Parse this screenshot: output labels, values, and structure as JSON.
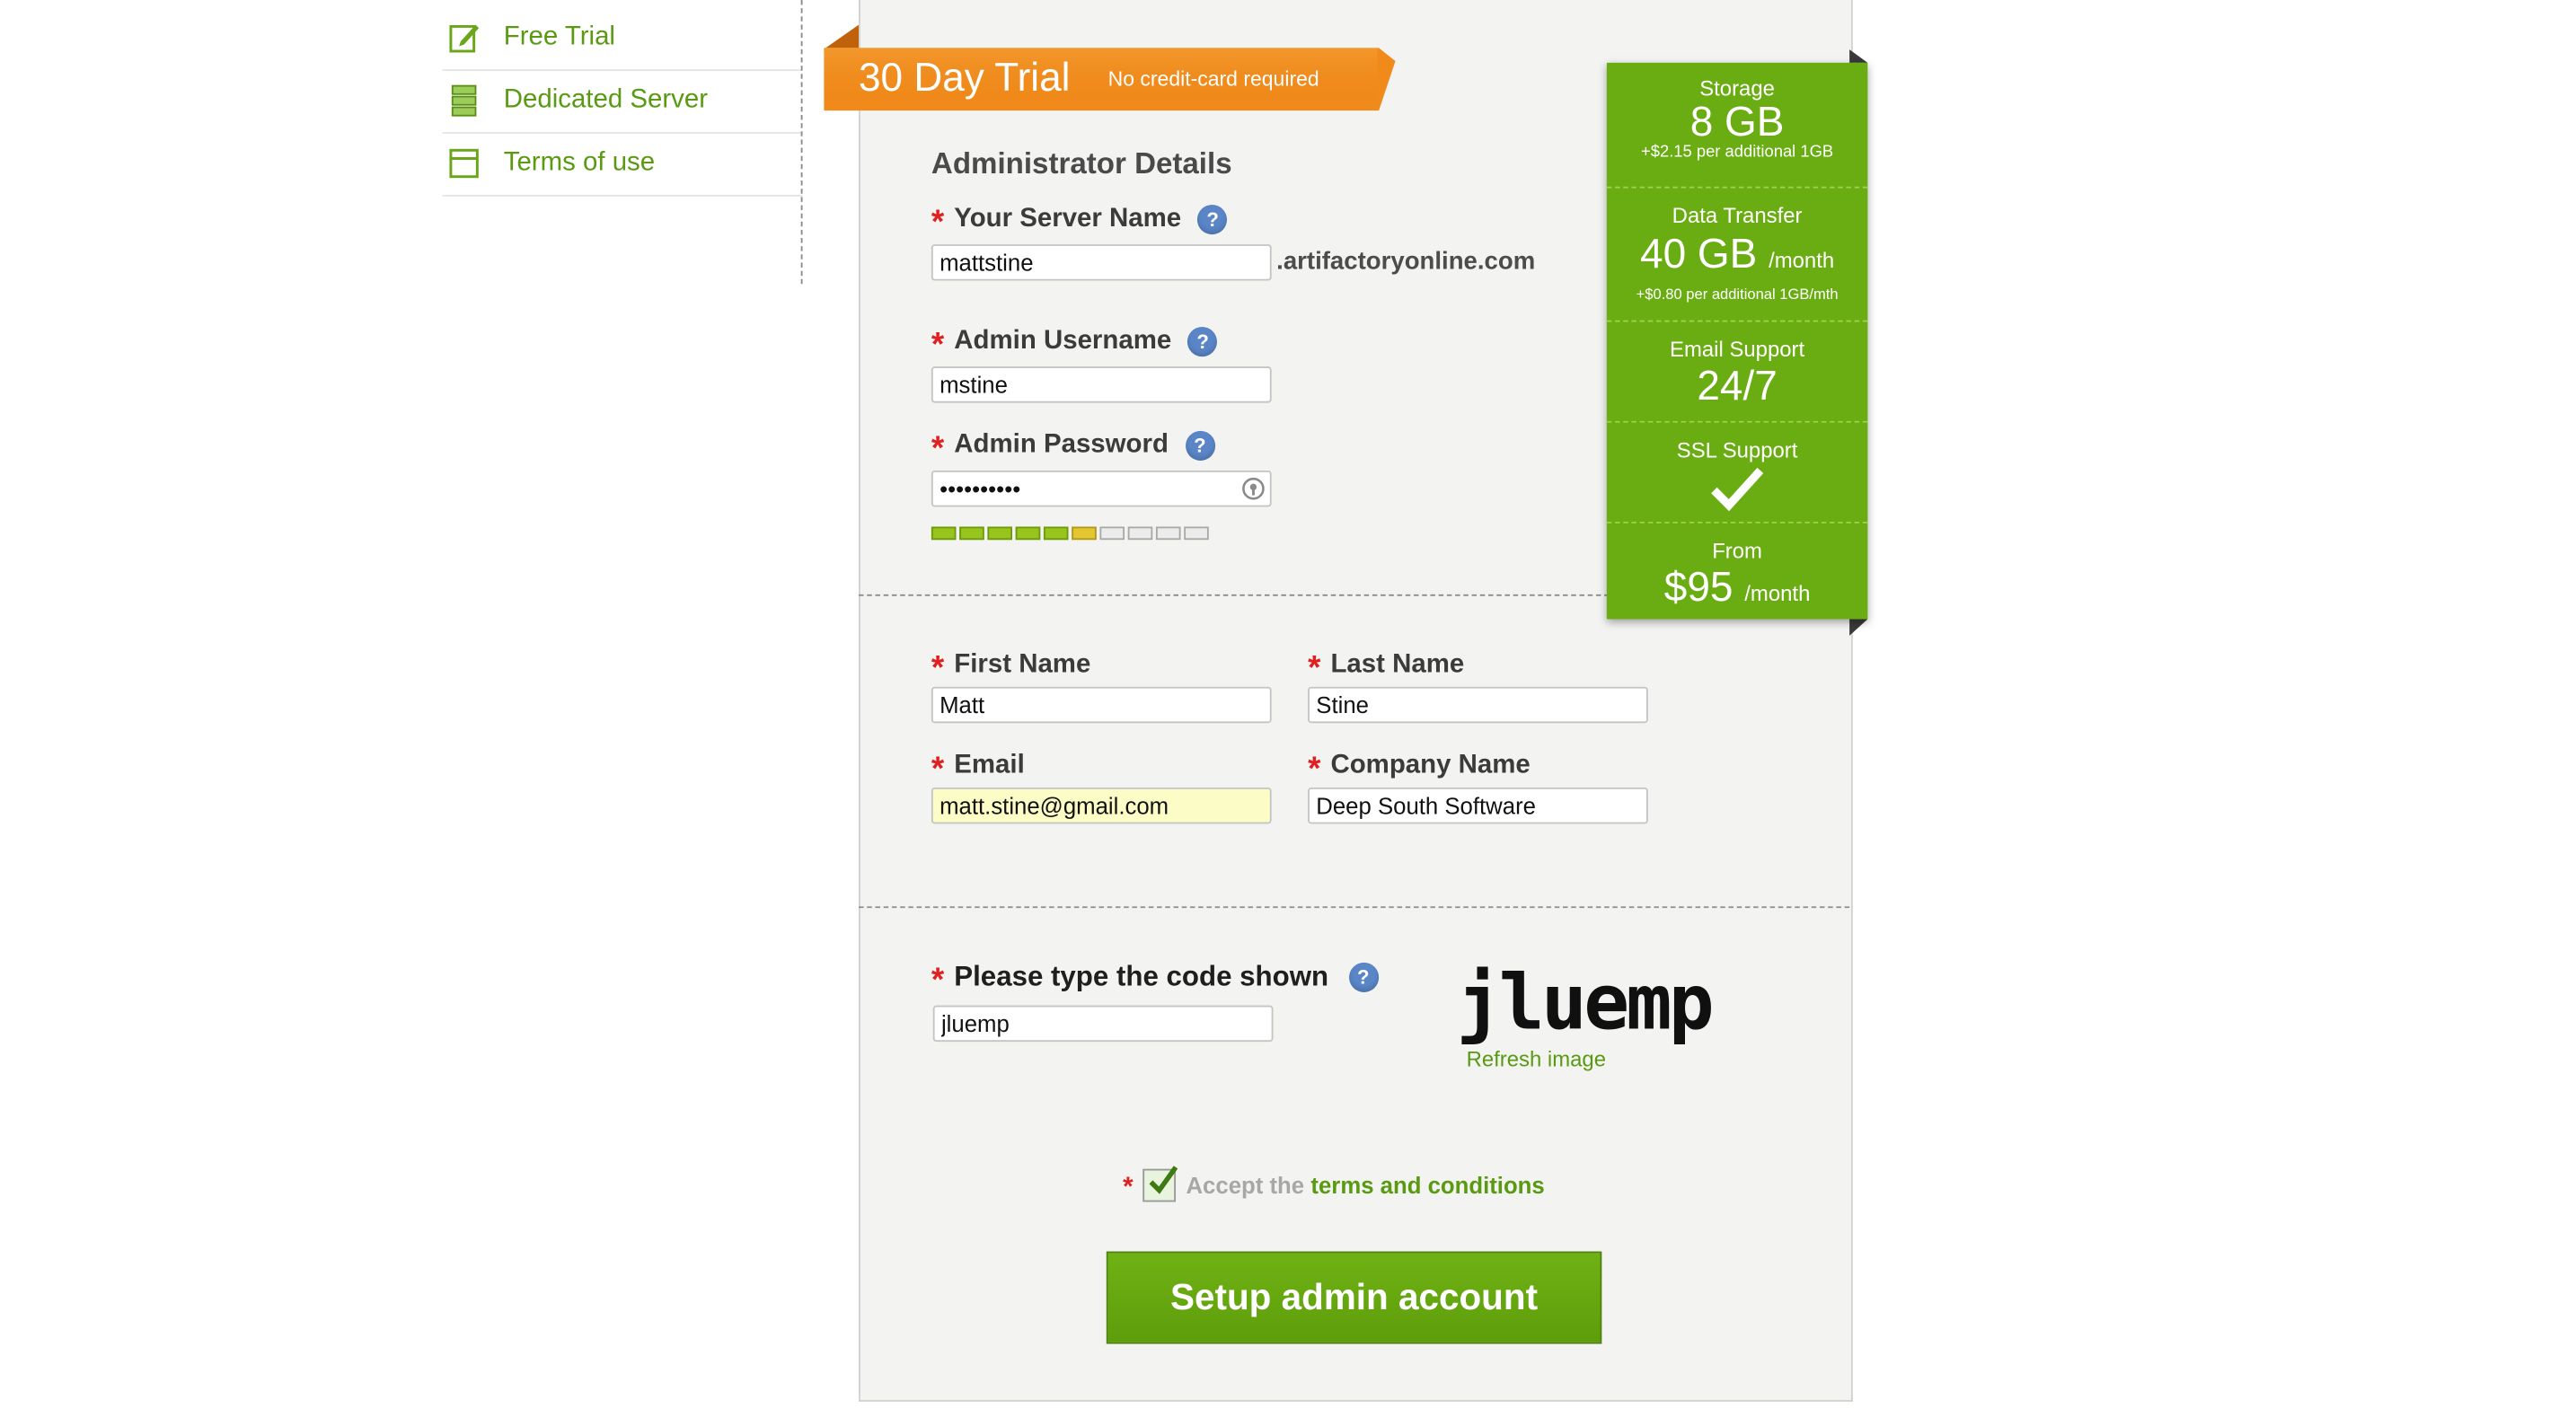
{
  "sidebar": {
    "items": [
      {
        "label": "Free Trial",
        "icon": "edit-icon"
      },
      {
        "label": "Dedicated Server",
        "icon": "server-stack-icon"
      },
      {
        "label": "Terms of use",
        "icon": "document-icon"
      }
    ]
  },
  "ribbon": {
    "title": "30 Day Trial",
    "subtitle": "No credit-card required"
  },
  "admin": {
    "heading": "Administrator Details",
    "server_name_label": "Your Server Name",
    "server_name_value": "mattstine",
    "server_suffix": ".artifactoryonline.com",
    "username_label": "Admin Username",
    "username_value": "mstine",
    "password_label": "Admin Password",
    "password_value": "••••••••••",
    "password_strength": {
      "filled": 6,
      "total": 10
    },
    "help": "?"
  },
  "personal": {
    "first_name_label": "First Name",
    "first_name_value": "Matt",
    "last_name_label": "Last Name",
    "last_name_value": "Stine",
    "email_label": "Email",
    "email_value": "matt.stine@gmail.com",
    "company_label": "Company Name",
    "company_value": "Deep South Software"
  },
  "captcha": {
    "label": "Please type the code shown",
    "value": "jluemp",
    "image_text": "jluemp",
    "refresh_label": "Refresh image"
  },
  "terms": {
    "prefix": "Accept the",
    "link": "terms and conditions",
    "checked": true
  },
  "submit_label": "Setup admin account",
  "required_mark": "*",
  "pricing": {
    "storage_title": "Storage",
    "storage_value": "8 GB",
    "storage_note": "+$2.15 per additional 1GB",
    "transfer_title": "Data Transfer",
    "transfer_value": "40 GB",
    "transfer_unit": "/month",
    "transfer_note": "+$0.80 per additional 1GB/mth",
    "email_title": "Email Support",
    "email_value": "24/7",
    "ssl_title": "SSL Support",
    "ssl_check": "✓",
    "from_title": "From",
    "price_value": "$95",
    "price_unit": "/month"
  },
  "colors": {
    "accent_green": "#6aad12",
    "link_green": "#5a9a12",
    "ribbon_orange": "#f08a1a",
    "required_red": "#e02020",
    "help_blue": "#5a86c8"
  }
}
